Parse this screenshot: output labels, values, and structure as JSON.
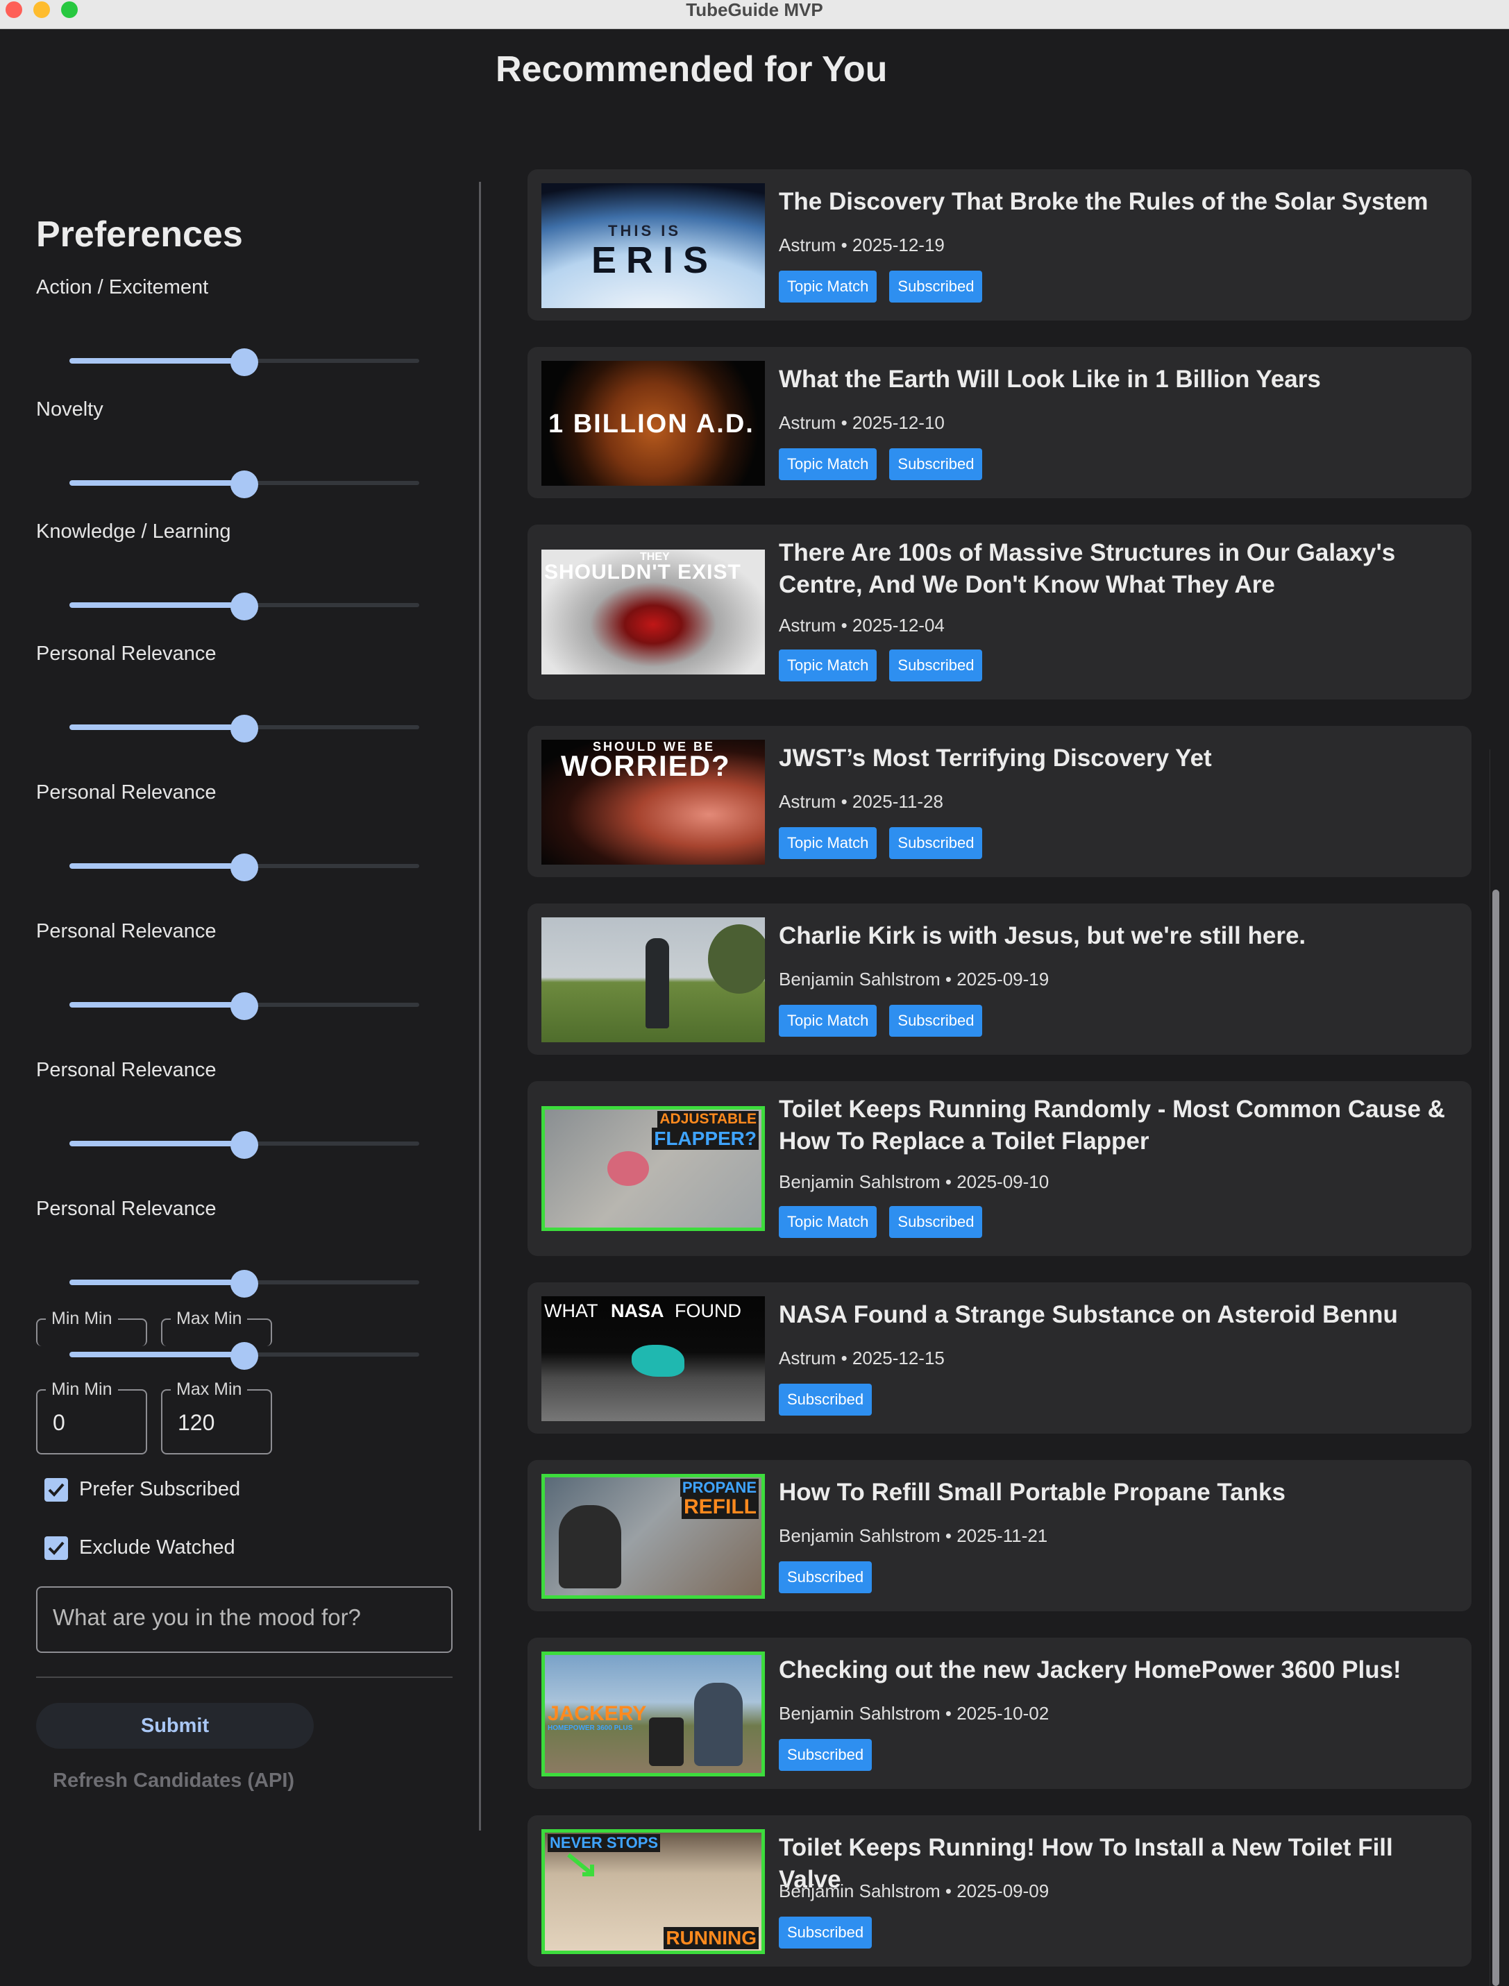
{
  "window": {
    "title": "TubeGuide MVP"
  },
  "main": {
    "heading": "Recommended for You"
  },
  "sidebar": {
    "heading": "Preferences",
    "sliders": [
      {
        "label": "Action / Excitement",
        "value": 0.5
      },
      {
        "label": "Novelty",
        "value": 0.5
      },
      {
        "label": "Knowledge / Learning",
        "value": 0.5
      },
      {
        "label": "Personal Relevance",
        "value": 0.5
      },
      {
        "label": "Personal Relevance",
        "value": 0.5
      },
      {
        "label": "Personal Relevance",
        "value": 0.5
      },
      {
        "label": "Personal Relevance",
        "value": 0.5
      },
      {
        "label": "Personal Relevance",
        "value": 0.5
      }
    ],
    "ghost_fields": {
      "min_label": "Min Min",
      "max_label": "Max Min"
    },
    "min_field": {
      "label": "Min Min",
      "value": "0"
    },
    "max_field": {
      "label": "Max Min",
      "value": "120"
    },
    "checkboxes": [
      {
        "label": "Prefer Subscribed",
        "checked": true
      },
      {
        "label": "Exclude Watched",
        "checked": true
      }
    ],
    "mood_input": {
      "placeholder": "What are you in the mood for?",
      "value": ""
    },
    "submit_label": "Submit",
    "refresh_label": "Refresh Candidates (API)"
  },
  "videos": [
    {
      "title": "The Discovery That Broke the Rules of the Solar System",
      "channel": "Astrum",
      "date": "2025-12-19",
      "meta": "Astrum • 2025-12-19",
      "badges": [
        "Topic Match",
        "Subscribed"
      ],
      "thumb_text": [
        "THIS IS",
        "ERIS"
      ]
    },
    {
      "title": "What the Earth Will Look Like in 1 Billion Years",
      "channel": "Astrum",
      "date": "2025-12-10",
      "meta": "Astrum • 2025-12-10",
      "badges": [
        "Topic Match",
        "Subscribed"
      ],
      "thumb_text": [
        "1 BILLION A.D."
      ]
    },
    {
      "title": "There Are 100s of Massive Structures in Our Galaxy's Centre, And We Don't Know What They Are",
      "channel": "Astrum",
      "date": "2025-12-04",
      "meta": "Astrum • 2025-12-04",
      "badges": [
        "Topic Match",
        "Subscribed"
      ],
      "thumb_text": [
        "THEY",
        "SHOULDN'T EXIST"
      ]
    },
    {
      "title": "JWST’s Most Terrifying Discovery Yet",
      "channel": "Astrum",
      "date": "2025-11-28",
      "meta": "Astrum • 2025-11-28",
      "badges": [
        "Topic Match",
        "Subscribed"
      ],
      "thumb_text": [
        "SHOULD WE BE",
        "WORRIED?"
      ]
    },
    {
      "title": "Charlie Kirk is with Jesus, but we're still here.",
      "channel": "Benjamin Sahlstrom",
      "date": "2025-09-19",
      "meta": "Benjamin Sahlstrom • 2025-09-19",
      "badges": [
        "Topic Match",
        "Subscribed"
      ],
      "thumb_text": []
    },
    {
      "title": "Toilet Keeps Running Randomly - Most Common Cause & How To Replace a Toilet Flapper",
      "channel": "Benjamin Sahlstrom",
      "date": "2025-09-10",
      "meta": "Benjamin Sahlstrom • 2025-09-10",
      "badges": [
        "Topic Match",
        "Subscribed"
      ],
      "thumb_text": [
        "ADJUSTABLE",
        "FLAPPER?"
      ]
    },
    {
      "title": "NASA Found a Strange Substance on Asteroid Bennu",
      "channel": "Astrum",
      "date": "2025-12-15",
      "meta": "Astrum • 2025-12-15",
      "badges": [
        "Subscribed"
      ],
      "thumb_text": [
        "WHAT",
        "NASA",
        "FOUND"
      ]
    },
    {
      "title": "How To Refill Small Portable Propane Tanks",
      "channel": "Benjamin Sahlstrom",
      "date": "2025-11-21",
      "meta": "Benjamin Sahlstrom • 2025-11-21",
      "badges": [
        "Subscribed"
      ],
      "thumb_text": [
        "PROPANE",
        "REFILL"
      ]
    },
    {
      "title": "Checking out the new Jackery HomePower 3600 Plus!",
      "channel": "Benjamin Sahlstrom",
      "date": "2025-10-02",
      "meta": "Benjamin Sahlstrom • 2025-10-02",
      "badges": [
        "Subscribed"
      ],
      "thumb_text": [
        "JACKERY",
        "HOMEPOWER 3600 PLUS"
      ]
    },
    {
      "title": "Toilet Keeps Running! How To Install a New Toilet Fill Valve",
      "channel": "Benjamin Sahlstrom",
      "date": "2025-09-09",
      "meta": "Benjamin Sahlstrom • 2025-09-09",
      "badges": [
        "Subscribed"
      ],
      "thumb_text": [
        "NEVER STOPS",
        "RUNNING"
      ]
    }
  ],
  "colors": {
    "accent": "#a9c7f5",
    "badge": "#2e8ff0",
    "card": "#2a2a2c",
    "background": "#1c1c1e"
  }
}
